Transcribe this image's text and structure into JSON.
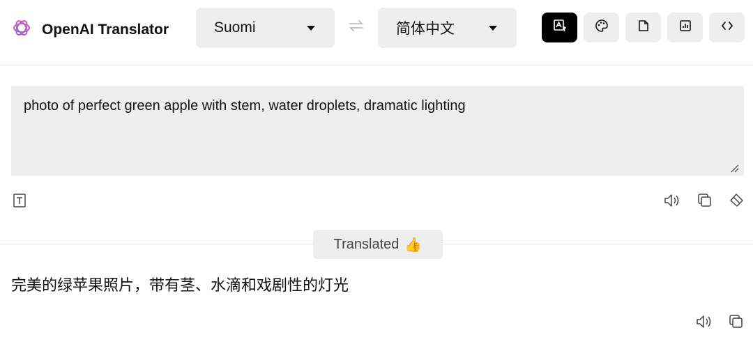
{
  "app": {
    "title": "OpenAI Translator"
  },
  "languages": {
    "source": "Suomi",
    "target": "简体中文"
  },
  "toolbar": {
    "tools": [
      {
        "name": "translate-tool",
        "icon": "translate-icon",
        "active": true
      },
      {
        "name": "theme-tool",
        "icon": "palette-icon",
        "active": false
      },
      {
        "name": "file-tool",
        "icon": "file-icon",
        "active": false
      },
      {
        "name": "stats-tool",
        "icon": "chart-icon",
        "active": false
      },
      {
        "name": "code-tool",
        "icon": "code-icon",
        "active": false
      }
    ]
  },
  "input": {
    "text": "photo of perfect green apple with stem, water droplets, dramatic lighting"
  },
  "status": {
    "label": "Translated",
    "emoji": "👍"
  },
  "output": {
    "text": "完美的绿苹果照片，带有茎、水滴和戏剧性的灯光"
  },
  "colors": {
    "panel": "#eeeeee",
    "active_tool": "#000000",
    "divider": "#e6e6e6"
  }
}
